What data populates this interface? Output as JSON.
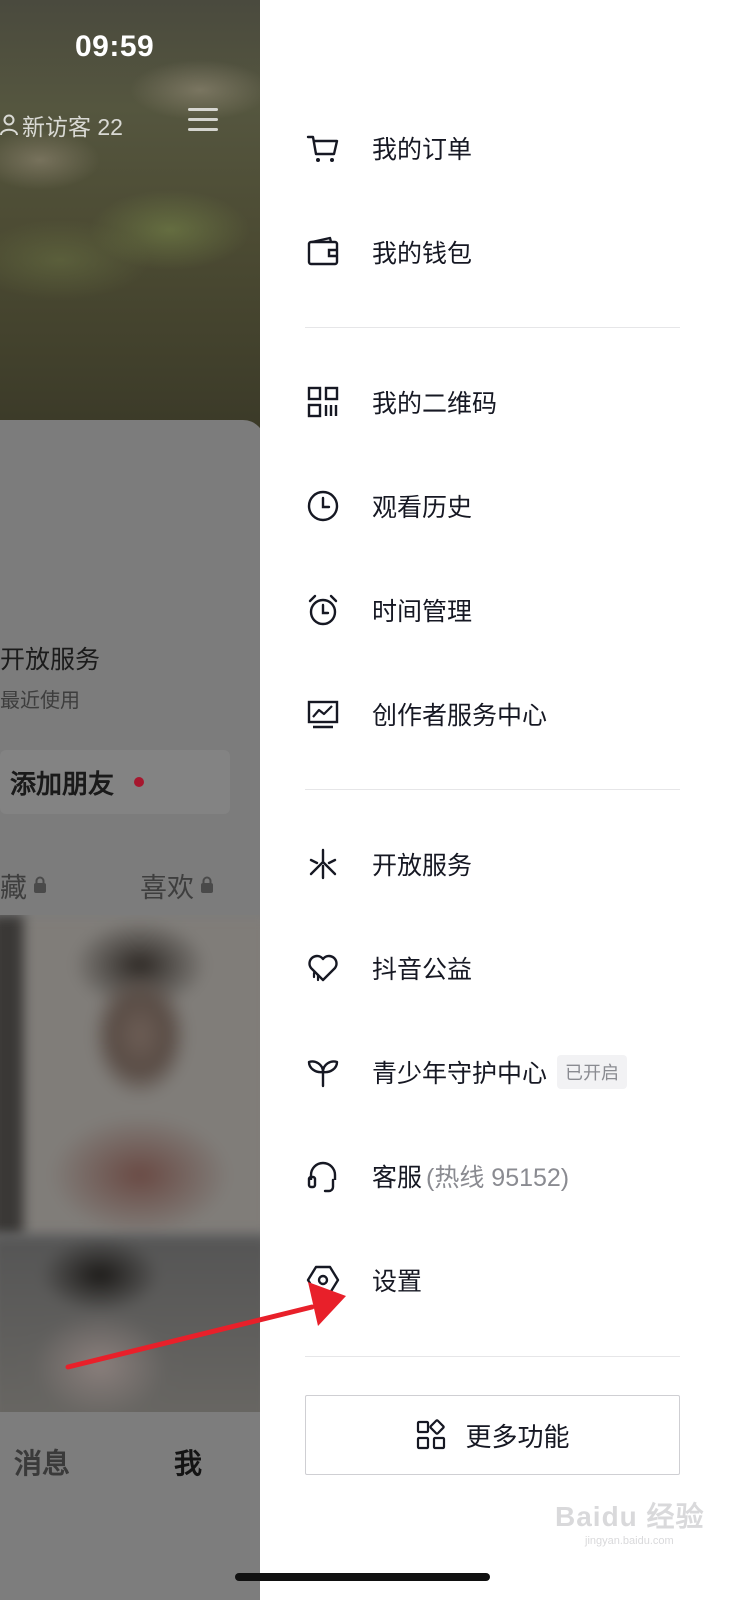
{
  "status_bar": {
    "time": "09:59"
  },
  "profile_bg": {
    "visitor_label": "新访客 22",
    "open_service_title": "开放服务",
    "open_service_sub": "最近使用",
    "add_friend_label": "添加朋友",
    "tab_collect": "藏",
    "tab_like": "喜欢",
    "nav_messages": "消息",
    "nav_me": "我"
  },
  "drawer": {
    "group1": [
      {
        "icon": "cart-icon",
        "label": "我的订单"
      },
      {
        "icon": "wallet-icon",
        "label": "我的钱包"
      }
    ],
    "group2": [
      {
        "icon": "qrcode-icon",
        "label": "我的二维码"
      },
      {
        "icon": "clock-icon",
        "label": "观看历史"
      },
      {
        "icon": "alarm-clock-icon",
        "label": "时间管理"
      },
      {
        "icon": "chart-monitor-icon",
        "label": "创作者服务中心"
      }
    ],
    "group3": [
      {
        "icon": "asterisk-icon",
        "label": "开放服务"
      },
      {
        "icon": "heart-icon",
        "label": "抖音公益"
      },
      {
        "icon": "sprout-icon",
        "label": "青少年守护中心",
        "badge": "已开启"
      },
      {
        "icon": "headset-icon",
        "label": "客服",
        "sub": "(热线 95152)"
      },
      {
        "icon": "hexagon-gear-icon",
        "label": "设置"
      }
    ],
    "more_button": {
      "icon": "apps-grid-icon",
      "label": "更多功能"
    }
  },
  "colors": {
    "accent_red": "#e8202a",
    "text": "#161823",
    "sub_text": "#8a8b91",
    "divider": "#e6e6e8"
  }
}
